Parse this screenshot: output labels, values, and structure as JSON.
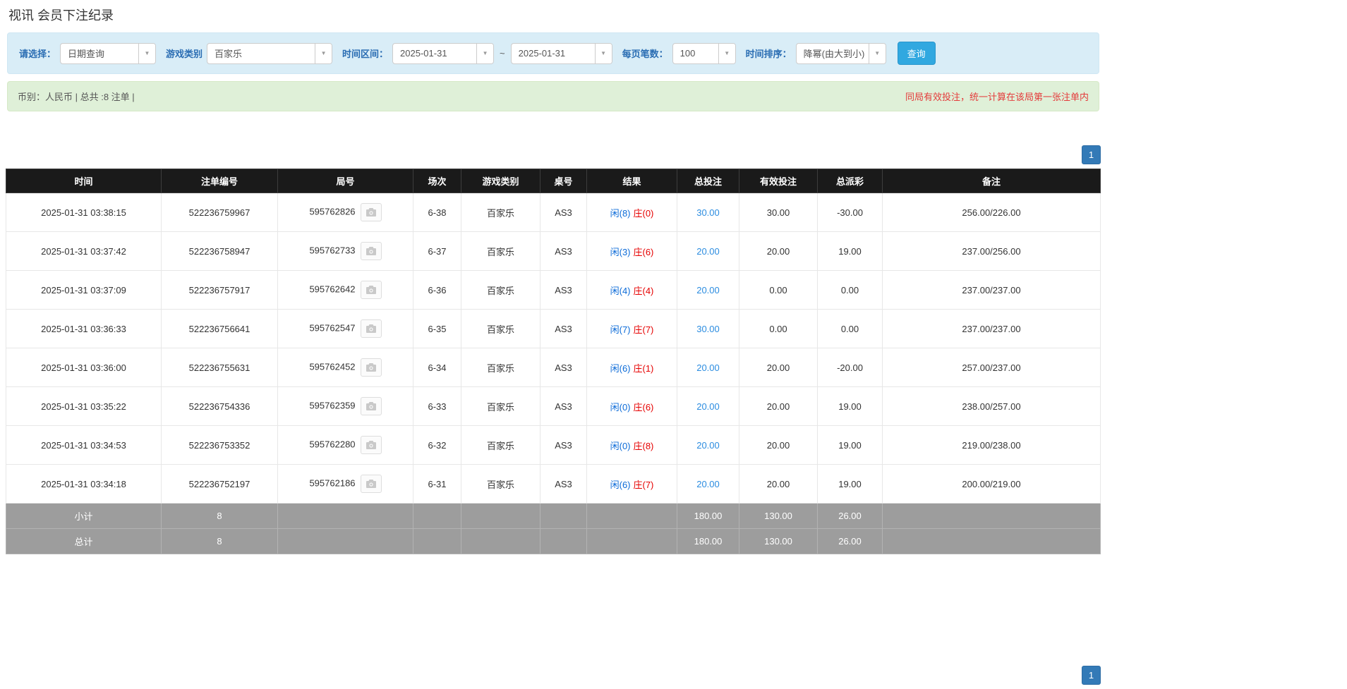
{
  "page": {
    "title": "视讯 会员下注纪录"
  },
  "filters": {
    "select_label": "请选择：",
    "select_value": "日期查询",
    "game_type_label": "游戏类别",
    "game_type_value": "百家乐",
    "time_range_label": "时间区间：",
    "date_from": "2025-01-31",
    "tilde": "~",
    "date_to": "2025-01-31",
    "per_page_label": "每页笔数：",
    "per_page_value": "100",
    "sort_label": "时间排序：",
    "sort_value": "降幂(由大到小)",
    "search_button": "查询"
  },
  "summary": {
    "left": "币别：人民币 | 总共 :8 注单 |",
    "right": "同局有效投注，统一计算在该局第一张注单内"
  },
  "pagination": {
    "page": "1"
  },
  "table": {
    "headers": [
      "时间",
      "注单编号",
      "局号",
      "场次",
      "游戏类别",
      "桌号",
      "结果",
      "总投注",
      "有效投注",
      "总派彩",
      "备注"
    ],
    "rows": [
      {
        "time": "2025-01-31 03:38:15",
        "bet_id": "522236759967",
        "round": "595762826",
        "session": "6-38",
        "game": "百家乐",
        "table_no": "AS3",
        "player": "闲(8)",
        "banker": "庄(0)",
        "total_bet": "30.00",
        "valid_bet": "30.00",
        "payout": "-30.00",
        "note": "256.00/226.00"
      },
      {
        "time": "2025-01-31 03:37:42",
        "bet_id": "522236758947",
        "round": "595762733",
        "session": "6-37",
        "game": "百家乐",
        "table_no": "AS3",
        "player": "闲(3)",
        "banker": "庄(6)",
        "total_bet": "20.00",
        "valid_bet": "20.00",
        "payout": "19.00",
        "note": "237.00/256.00"
      },
      {
        "time": "2025-01-31 03:37:09",
        "bet_id": "522236757917",
        "round": "595762642",
        "session": "6-36",
        "game": "百家乐",
        "table_no": "AS3",
        "player": "闲(4)",
        "banker": "庄(4)",
        "total_bet": "20.00",
        "valid_bet": "0.00",
        "payout": "0.00",
        "note": "237.00/237.00"
      },
      {
        "time": "2025-01-31 03:36:33",
        "bet_id": "522236756641",
        "round": "595762547",
        "session": "6-35",
        "game": "百家乐",
        "table_no": "AS3",
        "player": "闲(7)",
        "banker": "庄(7)",
        "total_bet": "30.00",
        "valid_bet": "0.00",
        "payout": "0.00",
        "note": "237.00/237.00"
      },
      {
        "time": "2025-01-31 03:36:00",
        "bet_id": "522236755631",
        "round": "595762452",
        "session": "6-34",
        "game": "百家乐",
        "table_no": "AS3",
        "player": "闲(6)",
        "banker": "庄(1)",
        "total_bet": "20.00",
        "valid_bet": "20.00",
        "payout": "-20.00",
        "note": "257.00/237.00"
      },
      {
        "time": "2025-01-31 03:35:22",
        "bet_id": "522236754336",
        "round": "595762359",
        "session": "6-33",
        "game": "百家乐",
        "table_no": "AS3",
        "player": "闲(0)",
        "banker": "庄(6)",
        "total_bet": "20.00",
        "valid_bet": "20.00",
        "payout": "19.00",
        "note": "238.00/257.00"
      },
      {
        "time": "2025-01-31 03:34:53",
        "bet_id": "522236753352",
        "round": "595762280",
        "session": "6-32",
        "game": "百家乐",
        "table_no": "AS3",
        "player": "闲(0)",
        "banker": "庄(8)",
        "total_bet": "20.00",
        "valid_bet": "20.00",
        "payout": "19.00",
        "note": "219.00/238.00"
      },
      {
        "time": "2025-01-31 03:34:18",
        "bet_id": "522236752197",
        "round": "595762186",
        "session": "6-31",
        "game": "百家乐",
        "table_no": "AS3",
        "player": "闲(6)",
        "banker": "庄(7)",
        "total_bet": "20.00",
        "valid_bet": "20.00",
        "payout": "19.00",
        "note": "200.00/219.00"
      }
    ],
    "subtotal": {
      "label": "小计",
      "count": "8",
      "total_bet": "180.00",
      "valid_bet": "130.00",
      "payout": "26.00"
    },
    "total": {
      "label": "总计",
      "count": "8",
      "total_bet": "180.00",
      "valid_bet": "130.00",
      "payout": "26.00"
    }
  },
  "colors": {
    "accent_blue": "#337ab7",
    "link_blue": "#2b8ce0",
    "player_blue": "#0c6bd8",
    "banker_red": "#e60000",
    "negative_red": "#e60000",
    "filter_bg": "#d9edf7",
    "summary_bg": "#dff0d8",
    "header_bg": "#1a1a1a",
    "footer_bg": "#9d9d9d"
  }
}
